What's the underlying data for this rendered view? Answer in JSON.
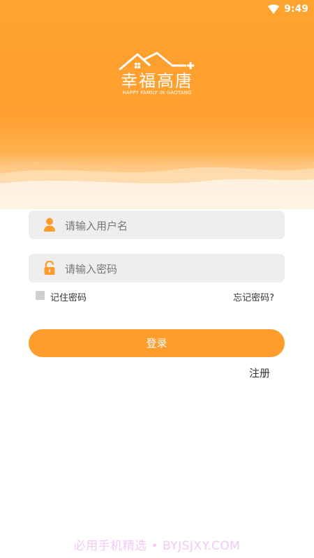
{
  "status_bar": {
    "time": "9:49",
    "wifi_icon": "wifi-icon"
  },
  "logo": {
    "title": "幸福高唐",
    "subtitle": "HAPPY FAMILY IN GAOTANG",
    "icon": "house-roof-icon"
  },
  "login_form": {
    "username": {
      "placeholder": "请输入用户名",
      "value": "",
      "icon": "user-icon"
    },
    "password": {
      "placeholder": "请输入密码",
      "value": "",
      "icon": "lock-icon"
    },
    "remember_label": "记住密码",
    "remember_checked": false,
    "forgot_label": "忘记密码?",
    "login_label": "登录",
    "register_label": "注册"
  },
  "watermark": "必用手机精选 • BYJSJXY.COM",
  "colors": {
    "accent": "#ff9d2c",
    "field_bg": "#eeeeee",
    "text": "#333333"
  }
}
